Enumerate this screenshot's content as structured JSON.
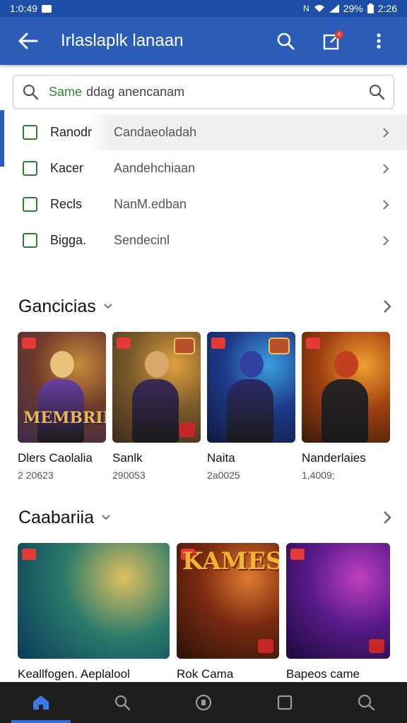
{
  "status_bar": {
    "time": "1:0:49",
    "battery": "29%",
    "clock": "2:26"
  },
  "app_bar": {
    "title": "Irlaslaplk lanaan",
    "back_icon": "arrow-left-icon",
    "actions": [
      "search-icon",
      "share-icon",
      "more-vert-icon"
    ],
    "notification_count": "6"
  },
  "search": {
    "chip": "Same",
    "query": "ddag anencanam",
    "placeholder": "ddag anencanam"
  },
  "filters": [
    {
      "name": "Ranodr",
      "value": "Candaeoladah",
      "checked": false
    },
    {
      "name": "Kacer",
      "value": "Aandehchiaan",
      "checked": false
    },
    {
      "name": "Recls",
      "value": "NanM.edban",
      "checked": false
    },
    {
      "name": "Bigga.",
      "value": "Sendecinl",
      "checked": false
    }
  ],
  "section1": {
    "title": "Gancicias",
    "cards": [
      {
        "name": "Dlers Caolalia",
        "meta": "2 20623",
        "logo": "MEMBRIIS",
        "palette": [
          "#3a2a4a",
          "#6e3b2a",
          "#c98a3c"
        ],
        "figure": [
          "#e8c27a",
          "#6a3fa0"
        ]
      },
      {
        "name": "Sanlk",
        "meta": "290053",
        "logo": "",
        "palette": [
          "#3c2a1c",
          "#7a5a2a",
          "#e0a040"
        ],
        "figure": [
          "#d6a86a",
          "#3a2a5a"
        ]
      },
      {
        "name": "Naita",
        "meta": "2a0025",
        "logo": "",
        "palette": [
          "#101a40",
          "#1e3a8a",
          "#3aa0e0"
        ],
        "figure": [
          "#3040a0",
          "#2a2a6a"
        ]
      },
      {
        "name": "Nanderlaies",
        "meta": "1,4009;",
        "logo": "",
        "palette": [
          "#3a1a0a",
          "#a04010",
          "#f0a030"
        ],
        "figure": [
          "#c04020",
          "#2a2222"
        ]
      }
    ]
  },
  "section2": {
    "title": "Caabariia",
    "cards": [
      {
        "name": "Keallfogen. Aeplalool",
        "logo": "",
        "palette": [
          "#0a3a5a",
          "#2a7a6a",
          "#e0c060"
        ],
        "figure": [
          "#2a2a2a",
          "#2a8a4a"
        ]
      },
      {
        "name": "Rok Cama",
        "logo": "KAMES",
        "palette": [
          "#2a120a",
          "#7a2a10",
          "#e07a30"
        ],
        "figure": [
          "#3a1a1a",
          "#a02a2a"
        ]
      },
      {
        "name": "Bapeos came",
        "logo": "",
        "palette": [
          "#1a0a3a",
          "#5a1a8a",
          "#c040c0"
        ],
        "figure": [
          "#2a2a4a",
          "#3a3a5a"
        ]
      }
    ]
  },
  "bottom_nav": [
    "home-icon",
    "search-icon",
    "compass-icon",
    "square-icon",
    "chat-search-icon"
  ]
}
